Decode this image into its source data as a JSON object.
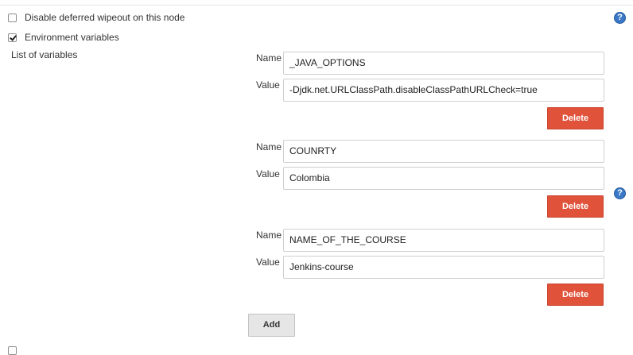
{
  "options": {
    "disable_wipeout": {
      "label": "Disable deferred wipeout on this node",
      "checked": false
    },
    "env_vars": {
      "label": "Environment variables",
      "checked": true
    }
  },
  "list_label": "List of variables",
  "field_labels": {
    "name": "Name",
    "value": "Value"
  },
  "variables": [
    {
      "name": "_JAVA_OPTIONS",
      "value": "-Djdk.net.URLClassPath.disableClassPathURLCheck=true"
    },
    {
      "name": "COUNRTY",
      "value": "Colombia"
    },
    {
      "name": "NAME_OF_THE_COURSE",
      "value": "Jenkins-course"
    }
  ],
  "buttons": {
    "delete": "Delete",
    "add": "Add"
  },
  "help_glyph": "?",
  "icons": {
    "help": "help-icon"
  },
  "colors": {
    "delete_button": "#e0523a",
    "help_icon": "#3a78c7"
  }
}
